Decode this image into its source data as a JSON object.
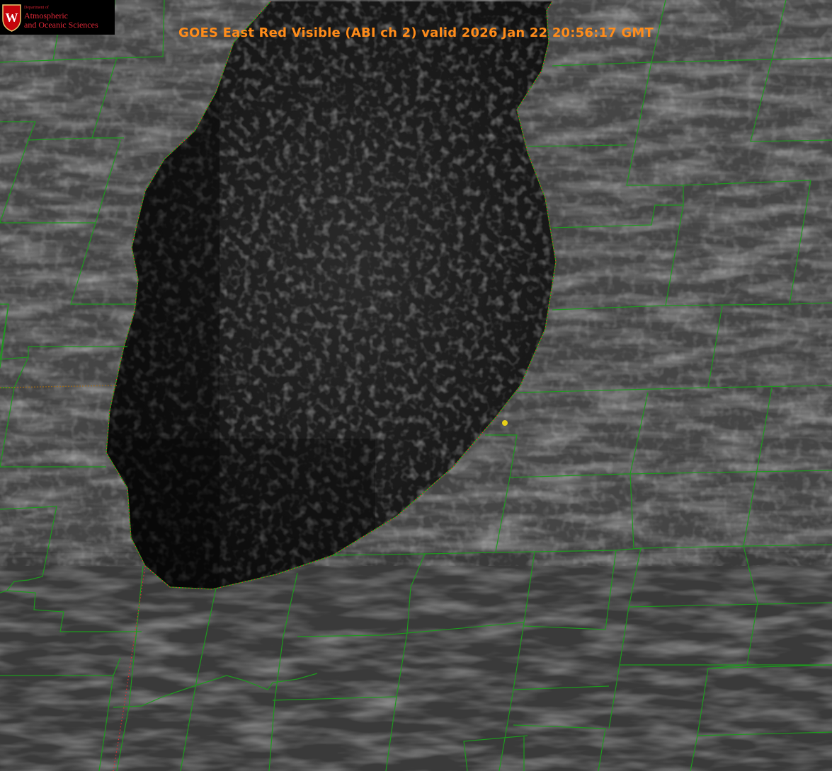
{
  "title": "GOES East Red Visible (ABI ch 2) valid 2026 Jan 22 20:56:17 GMT",
  "logo": {
    "department": "Department of",
    "line1": "Atmospheric",
    "line2": "and Oceanic Sciences",
    "crest_letter": "W",
    "icon": "uw-crest-icon"
  },
  "colors": {
    "title": "#ff8c1a",
    "county_lines": "#1e9a1e",
    "coastline_dots": "#e03030",
    "state_line": "#9c6a1a",
    "marker": "#e8d018",
    "lake": "#121212",
    "land": "#4a4a4a"
  },
  "layers": [
    "cloud-texture",
    "lake",
    "county-lines",
    "coastline",
    "state-line",
    "marker"
  ]
}
